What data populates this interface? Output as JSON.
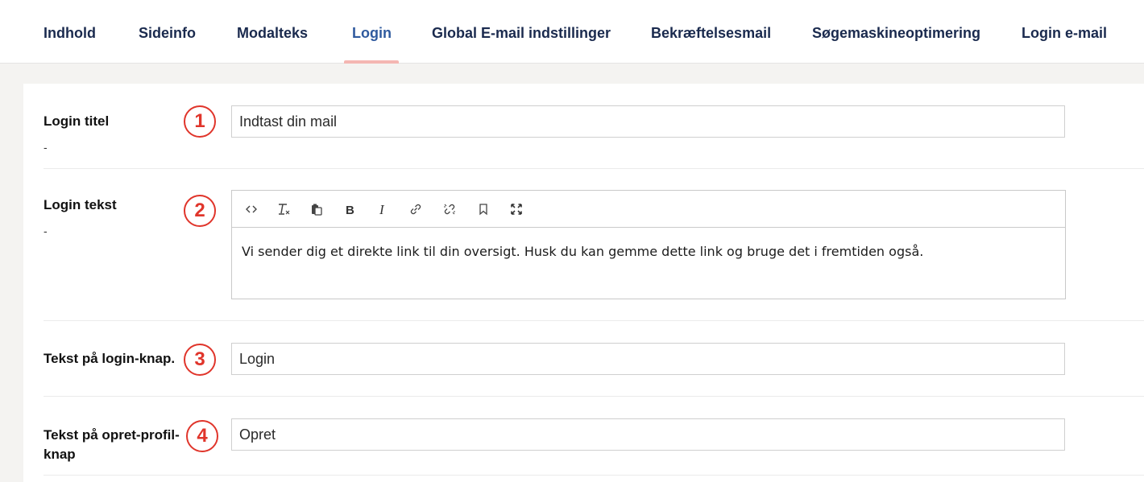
{
  "tabs": [
    {
      "label": "Indhold",
      "active": false
    },
    {
      "label": "Sideinfo",
      "active": false
    },
    {
      "label": "Modalteks",
      "active": false
    },
    {
      "label": "Login",
      "active": true
    },
    {
      "label": "Global E-mail indstillinger",
      "active": false
    },
    {
      "label": "Bekræftelsesmail",
      "active": false
    },
    {
      "label": "Søgemaskineoptimering",
      "active": false
    },
    {
      "label": "Login e-mail",
      "active": false
    }
  ],
  "form": {
    "login_title": {
      "label": "Login titel",
      "sub": "-",
      "badge": "1",
      "value": "Indtast din mail"
    },
    "login_text": {
      "label": "Login tekst",
      "sub": "-",
      "badge": "2",
      "value": "Vi sender dig et direkte link til din oversigt. Husk du kan gemme dette link og bruge det i fremtiden også.",
      "toolbar": [
        "source-icon",
        "remove-format-icon",
        "paste-icon",
        "bold-icon",
        "italic-icon",
        "link-icon",
        "unlink-icon",
        "bookmark-icon",
        "fullscreen-icon"
      ]
    },
    "login_button": {
      "label": "Tekst på login-knap.",
      "badge": "3",
      "value": "Login"
    },
    "create_profile_button": {
      "label_line1": "Tekst på opret-profil-",
      "label_line2": "knap",
      "badge": "4",
      "value": "Opret"
    }
  },
  "colors": {
    "badge": "#e0352b",
    "active_tab": "#2f5a9e",
    "tab": "#1a2a4e",
    "underline": "#f4b6b2"
  }
}
